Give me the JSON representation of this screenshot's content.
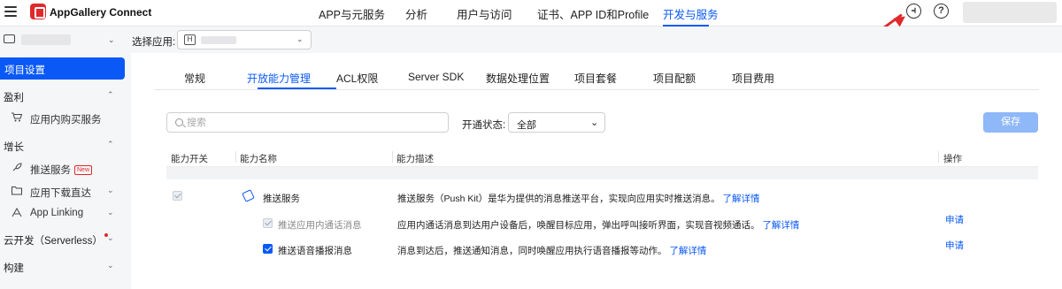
{
  "brand": {
    "name": "AppGallery Connect"
  },
  "nav": {
    "items": [
      {
        "label": "APP与元服务"
      },
      {
        "label": "分析"
      },
      {
        "label": "用户与访问"
      },
      {
        "label": "证书、APP ID和Profile"
      },
      {
        "label": "开发与服务",
        "active": true
      }
    ]
  },
  "header_icons": [
    "support-icon",
    "help-icon"
  ],
  "subbar": {
    "select_app_label": "选择应用:",
    "app_badge": "H"
  },
  "sidebar": {
    "active": "项目设置",
    "groups": [
      {
        "label": "盈利",
        "items": [
          {
            "label": "应用内购买服务",
            "icon": "cart-icon"
          }
        ]
      },
      {
        "label": "增长",
        "items": [
          {
            "label": "推送服务",
            "icon": "rocket-icon",
            "badge": "New"
          },
          {
            "label": "应用下载直达",
            "icon": "folder-icon"
          },
          {
            "label": "App Linking",
            "icon": "link-icon"
          }
        ]
      },
      {
        "label": "云开发（Serverless）",
        "dot": true
      },
      {
        "label": "构建"
      }
    ]
  },
  "tabs": [
    {
      "label": "常规"
    },
    {
      "label": "开放能力管理",
      "active": true
    },
    {
      "label": "ACL权限"
    },
    {
      "label": "Server SDK"
    },
    {
      "label": "数据处理位置"
    },
    {
      "label": "项目套餐"
    },
    {
      "label": "项目配额"
    },
    {
      "label": "项目费用"
    }
  ],
  "filter": {
    "search_placeholder": "搜索",
    "status_label": "开通状态:",
    "status_value": "全部",
    "save_label": "保存"
  },
  "table": {
    "headers": [
      "能力开关",
      "能力名称",
      "能力描述",
      "操作"
    ],
    "rows": [
      {
        "name": "推送服务",
        "desc": "推送服务（Push Kit）是华为提供的消息推送平台，实现向应用实时推送消息。",
        "link": "了解详情",
        "checked": "disabled",
        "action": ""
      },
      {
        "name": "推送应用内通话消息",
        "desc": "应用内通话消息到达用户设备后，唤醒目标应用，弹出呼叫接听界面，实现音视频通话。",
        "link": "了解详情",
        "checked": "disabled",
        "action": "申请"
      },
      {
        "name": "推送语音播报消息",
        "desc": "消息到达后，推送通知消息，同时唤醒应用执行语音播报等动作。",
        "link": "了解详情",
        "checked": "on",
        "action": "申请"
      }
    ]
  },
  "colors": {
    "accent": "#0a59f7",
    "annotation": "#e0292b"
  }
}
